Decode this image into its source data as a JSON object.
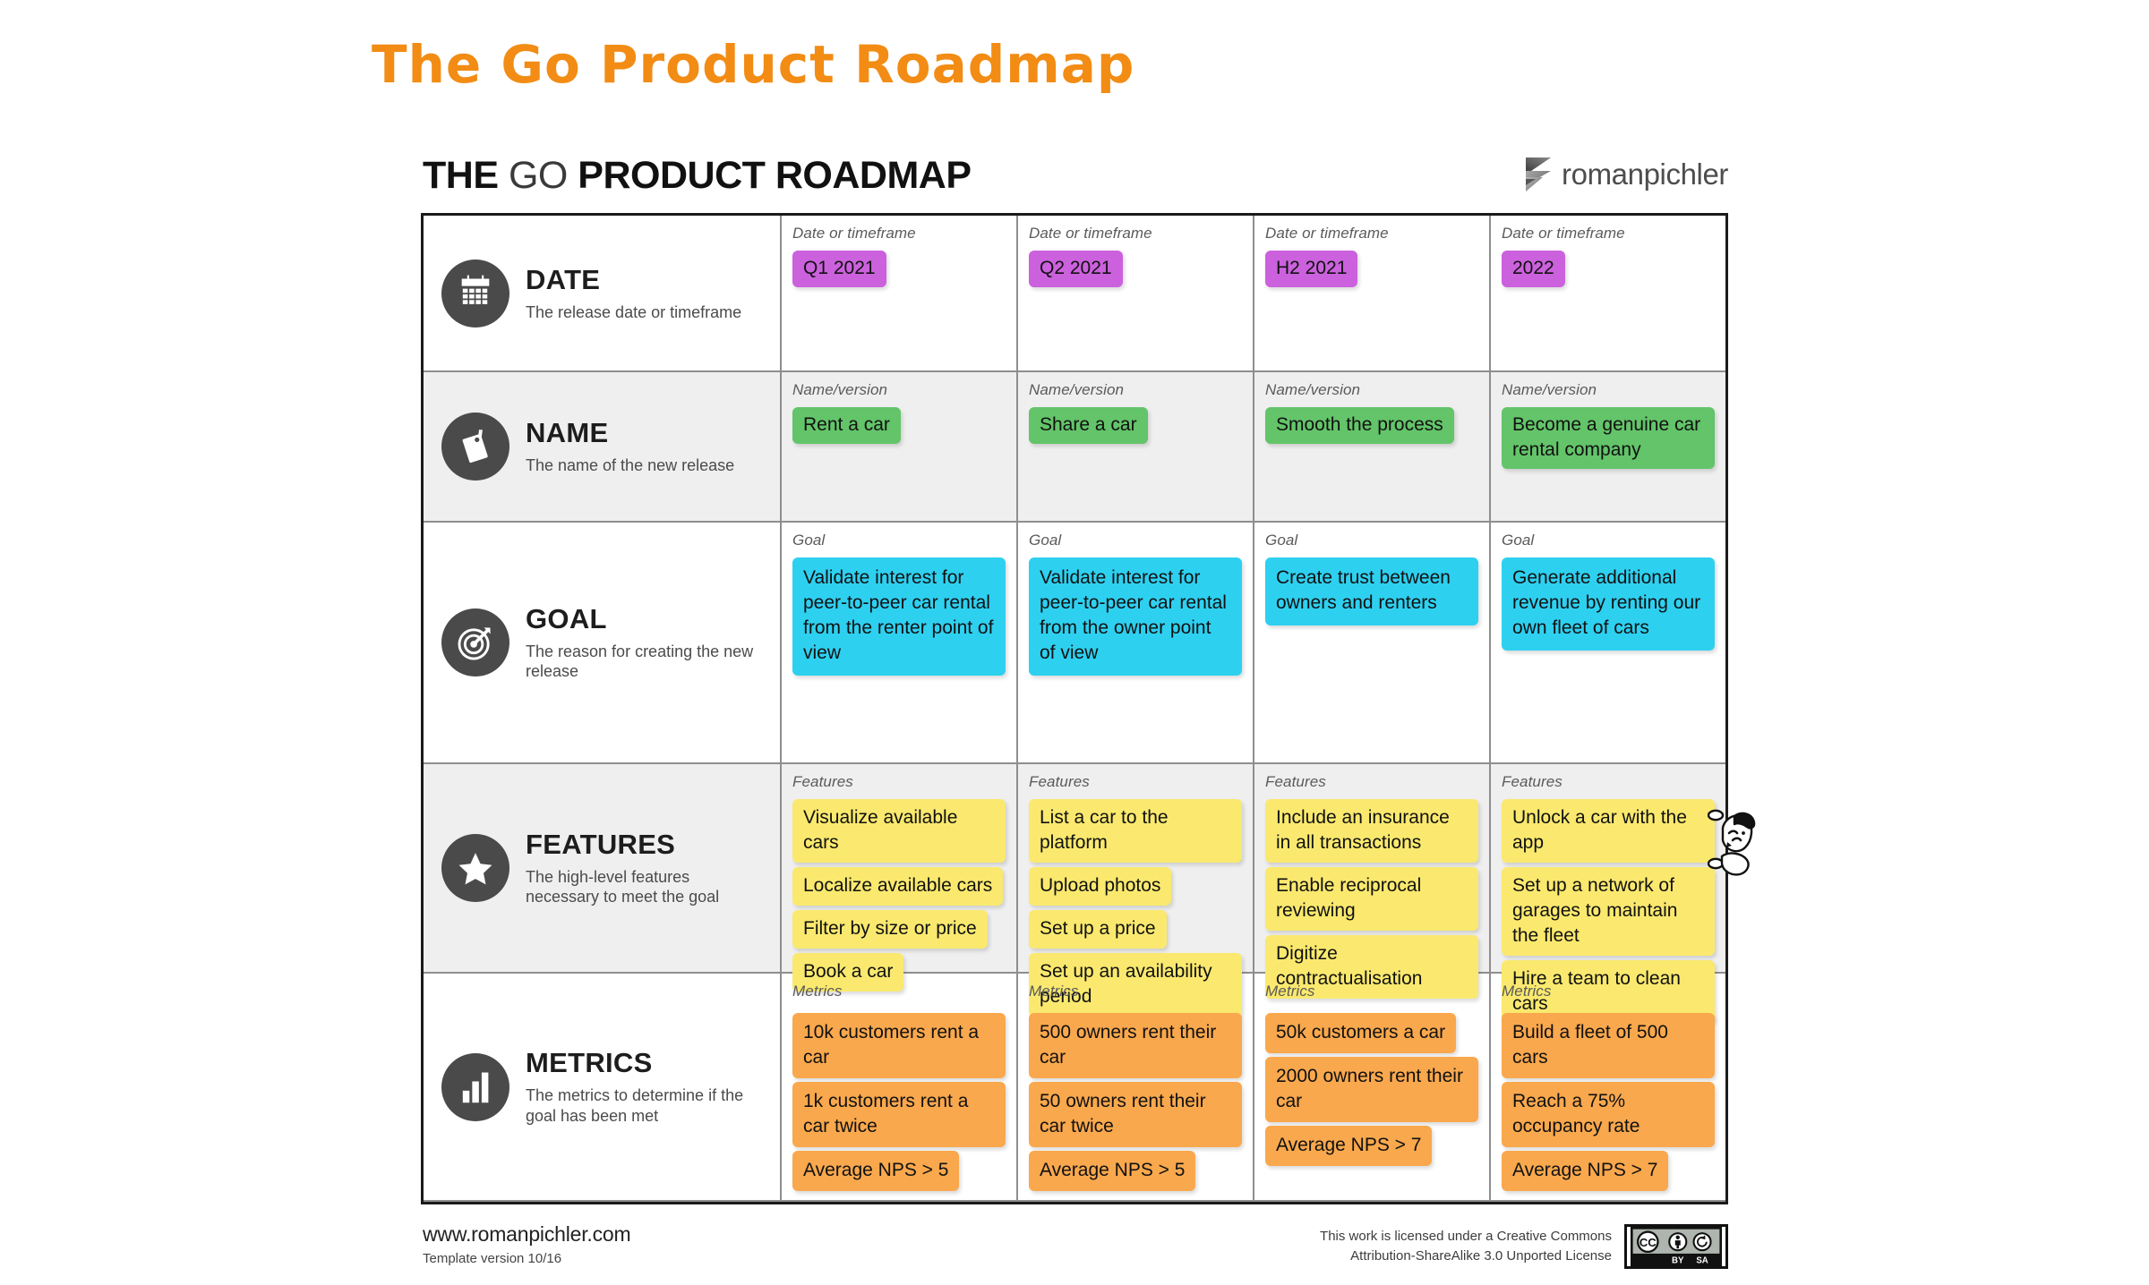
{
  "slide": {
    "title": "The Go Product Roadmap",
    "title_color": "#F28C14"
  },
  "sheet": {
    "header": {
      "title_part1": "THE ",
      "title_go": "GO",
      "title_part2": " PRODUCT ROADMAP",
      "brand_name": "romanpichler",
      "brand_mark_icon": "zigzag-ribbon-icon"
    },
    "rows": [
      {
        "key": "date",
        "icon": "calendar-icon",
        "title": "DATE",
        "subtitle": "The release date or timeframe",
        "cell_label": "Date or timeframe",
        "note_color": "#CB61DD",
        "cells": [
          {
            "notes": [
              "Q1 2021"
            ]
          },
          {
            "notes": [
              "Q2 2021"
            ]
          },
          {
            "notes": [
              "H2 2021"
            ]
          },
          {
            "notes": [
              "2022"
            ]
          }
        ]
      },
      {
        "key": "name",
        "icon": "price-tag-icon",
        "title": "NAME",
        "subtitle": "The name of the new release",
        "cell_label": "Name/version",
        "note_color": "#63C469",
        "cells": [
          {
            "notes": [
              "Rent a car"
            ]
          },
          {
            "notes": [
              "Share a car"
            ]
          },
          {
            "notes": [
              "Smooth the process"
            ]
          },
          {
            "notes": [
              "Become a genuine car rental company"
            ]
          }
        ]
      },
      {
        "key": "goal",
        "icon": "target-icon",
        "title": "GOAL",
        "subtitle": "The reason for creating the new release",
        "cell_label": "Goal",
        "note_color": "#2ED0F0",
        "cells": [
          {
            "notes": [
              "Validate interest for peer-to-peer car rental from the renter point of view"
            ]
          },
          {
            "notes": [
              "Validate interest for peer-to-peer car rental from the owner point of view"
            ]
          },
          {
            "notes": [
              "Create trust between owners and renters"
            ]
          },
          {
            "notes": [
              "Generate additional revenue by renting our own fleet of cars"
            ]
          }
        ]
      },
      {
        "key": "features",
        "icon": "star-icon",
        "title": "FEATURES",
        "subtitle": "The high-level features necessary to meet the goal",
        "cell_label": "Features",
        "note_color": "#FAE96E",
        "cells": [
          {
            "notes": [
              "Visualize available cars",
              "Localize available cars",
              "Filter by size or price",
              "Book a car"
            ]
          },
          {
            "notes": [
              "List a car to the platform",
              "Upload photos",
              "Set up a price",
              "Set up an availability period"
            ]
          },
          {
            "notes": [
              "Include an insurance in all transactions",
              "Enable reciprocal reviewing",
              "Digitize contractualisation"
            ]
          },
          {
            "notes": [
              "Unlock a car with the app",
              "Set up a network of garages to maintain the fleet",
              "Hire a team to clean cars"
            ]
          }
        ]
      },
      {
        "key": "metrics",
        "icon": "bar-chart-icon",
        "title": "METRICS",
        "subtitle": "The metrics to determine if the goal has been met",
        "cell_label": "Metrics",
        "note_color": "#F9A84D",
        "cells": [
          {
            "notes": [
              "10k customers rent a car",
              "1k customers rent a car twice",
              "Average NPS > 5"
            ]
          },
          {
            "notes": [
              "500 owners rent their car",
              "50 owners rent their car twice",
              "Average NPS > 5"
            ]
          },
          {
            "notes": [
              "50k customers a car",
              "2000 owners rent their car",
              "Average NPS > 7"
            ]
          },
          {
            "notes": [
              "Build a fleet of 500 cars",
              "Reach a 75% occupancy rate",
              "Average NPS > 7"
            ]
          }
        ]
      }
    ],
    "doodle_icon": "peeking-person-doodle-icon",
    "footer": {
      "url": "www.romanpichler.com",
      "version": "Template version 10/16",
      "license_line1": "This work is licensed under a Creative Commons",
      "license_line2": "Attribution-ShareAlike 3.0 Unported License",
      "cc_badge_icon": "creative-commons-by-sa-badge-icon",
      "cc_label": "CC",
      "by_label": "BY",
      "sa_label": "SA"
    }
  }
}
